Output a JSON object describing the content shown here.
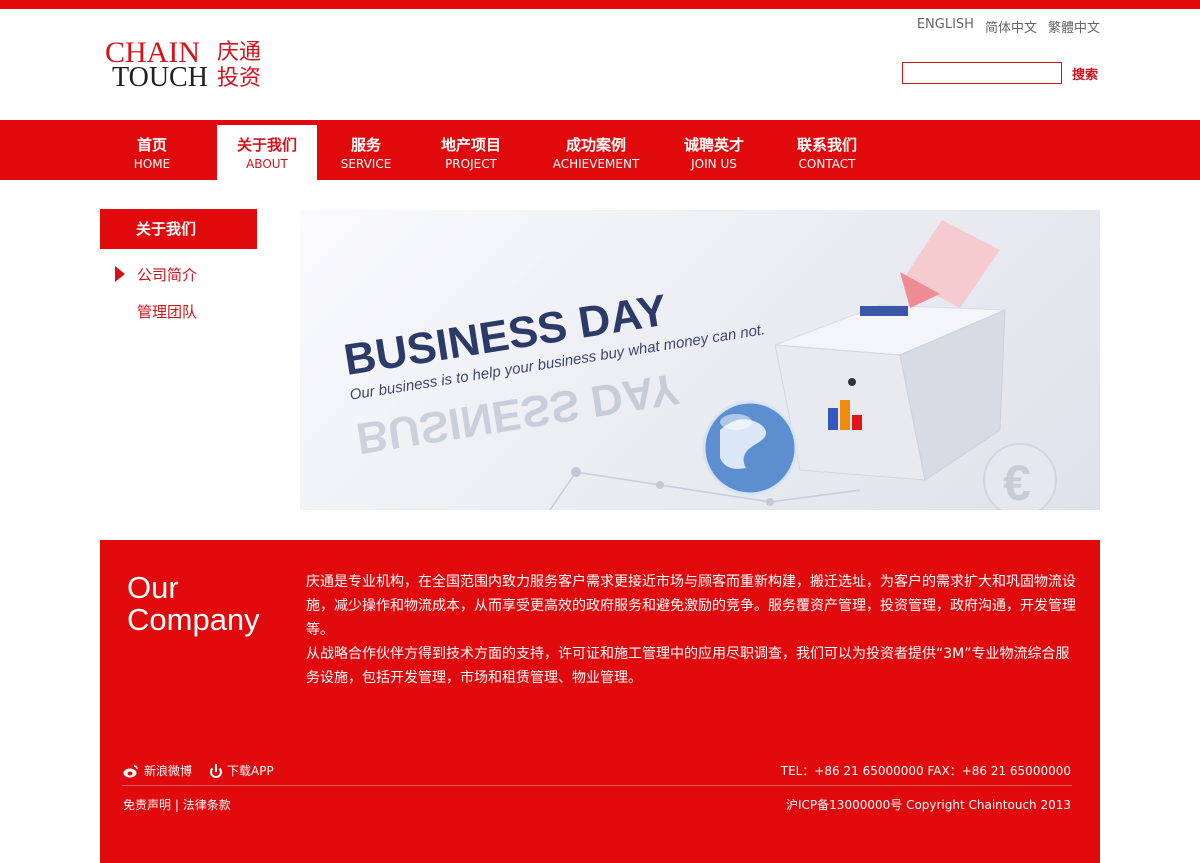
{
  "logo": {
    "en_line1": "CHAIN",
    "en_line2": "TOUCH",
    "cn_line1": "庆通",
    "cn_line2": "投资"
  },
  "lang": [
    "ENGLISH",
    "简体中文",
    "繁體中文"
  ],
  "search": {
    "button": "搜索",
    "value": "",
    "placeholder": ""
  },
  "nav": [
    {
      "cn": "首页",
      "en": "HOME"
    },
    {
      "cn": "关于我们",
      "en": "ABOUT"
    },
    {
      "cn": "服务",
      "en": "SERVICE"
    },
    {
      "cn": "地产项目",
      "en": "PROJECT"
    },
    {
      "cn": "成功案例",
      "en": "ACHIEVEMENT"
    },
    {
      "cn": "诚聘英才",
      "en": "JOIN US"
    },
    {
      "cn": "联系我们",
      "en": "CONTACT"
    }
  ],
  "sidebar": {
    "title": "关于我们",
    "items": [
      "公司简介",
      "管理团队"
    ]
  },
  "banner": {
    "headline": "BUSINESS DAY",
    "tagline": "Our business is to help your business buy what money can not."
  },
  "section": {
    "title1": "Our",
    "title2": "Company",
    "para1": "庆通是专业机构，在全国范围内致力服务客户需求更接近市场与顾客而重新构建，搬迁选址，为客户的需求扩大和巩固物流设施，减少操作和物流成本，从而享受更高效的政府服务和避免激励的竞争。服务覆资产管理，投资管理，政府沟通，开发管理等。",
    "para2": "从战略合作伙伴方得到技术方面的支持，许可证和施工管理中的应用尽职调查，我们可以为投资者提供“3M”专业物流综合服务设施，包括开发管理，市场和租赁管理、物业管理。"
  },
  "footer": {
    "weibo": "新浪微博",
    "app": "下载APP",
    "tel": "TEL：+86 21 65000000  FAX：+86 21 65000000",
    "disclaimer": "免责声明",
    "sep": " | ",
    "terms": "法律条款",
    "copyright": "沪ICP备13000000号  Copyright Chaintouch 2013"
  },
  "colors": {
    "brand_red": "#e00a0c",
    "text_red": "#d3121b"
  }
}
